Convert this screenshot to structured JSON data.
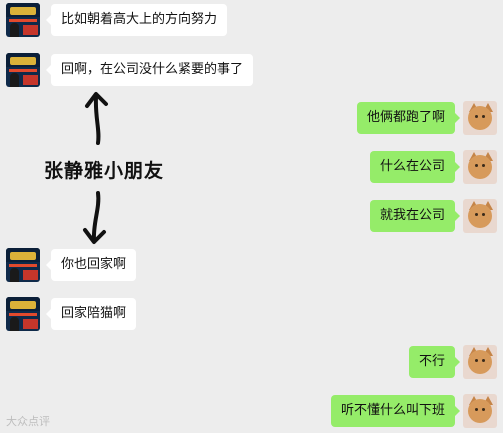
{
  "messages": [
    {
      "side": "left",
      "text": "比如朝着高大上的方向努力"
    },
    {
      "side": "left",
      "text": "回啊，在公司没什么紧要的事了"
    },
    {
      "side": "right",
      "text": "他俩都跑了啊"
    },
    {
      "side": "right",
      "text": "什么在公司"
    },
    {
      "side": "right",
      "text": "就我在公司"
    },
    {
      "side": "left",
      "text": "你也回家啊"
    },
    {
      "side": "left",
      "text": "回家陪猫啊"
    },
    {
      "side": "right",
      "text": "不行"
    },
    {
      "side": "right",
      "text": "听不懂什么叫下班"
    }
  ],
  "annotation": "张静雅小朋友",
  "watermark": "大众点评",
  "colors": {
    "background": "#ededed",
    "bubble_left": "#ffffff",
    "bubble_right": "#95ec69"
  },
  "icons": {
    "left_avatar": "contact-avatar-poster",
    "right_avatar": "cat-avatar"
  }
}
